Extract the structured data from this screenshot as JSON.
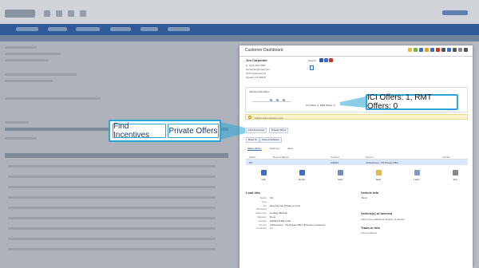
{
  "modal": {
    "title": "Customer Dashboard",
    "toolbar_icon_colors": [
      "#f2b632",
      "#7bb04a",
      "#3b6fc4",
      "#e0a030",
      "#3b6fc4",
      "#c0392b",
      "#555555",
      "#3b6fc4",
      "#555555",
      "#888888",
      "#555555"
    ]
  },
  "customer": {
    "name": "Jim Carpenter",
    "phone": "H: (123) 456-7890",
    "email": "jcarpenter@email.com",
    "address": "3470 Sycamore St",
    "city": "Topeka, KS 66546",
    "search_label": "Search:"
  },
  "vehicle": {
    "section_title": "Vehicle Information",
    "offers_text": "ICI Offers: 1, RMT Offers: 0"
  },
  "alert": {
    "text": "Click to add customer note"
  },
  "buttons": {
    "find_incentives": "Find Incentives",
    "private_offers": "Private Offers",
    "book_to": "Book To",
    "owned_vehicles": "Owned Vehicles"
  },
  "tabs": [
    "Sales History",
    "Deal Log",
    "Value"
  ],
  "grid": {
    "headers": [
      "Status",
      "Buyer/CoBuyer",
      "Created",
      "Source",
      "Vehicle"
    ],
    "rows": [
      {
        "status": "NO",
        "buyer": "",
        "created": "2/18/24",
        "source": "VinSolutions - VS Private Offer",
        "vehicle": ""
      }
    ]
  },
  "actions": [
    {
      "label": "Call",
      "icon": "phone-icon",
      "color": "#3b6fc4"
    },
    {
      "label": "Email",
      "icon": "email-icon",
      "color": "#3b6fc4"
    },
    {
      "label": "Appt",
      "icon": "calendar-icon",
      "color": "#6b8ec9"
    },
    {
      "label": "Note",
      "icon": "note-icon",
      "color": "#e6b84a"
    },
    {
      "label": "Letter",
      "icon": "letter-icon",
      "color": "#7d9bcf"
    },
    {
      "label": "Text",
      "icon": "text-icon",
      "color": "#888888"
    }
  ],
  "lead_info": {
    "title": "Lead Info",
    "rows": [
      {
        "k": "Status",
        "v": "NO",
        "red": false
      },
      {
        "k": "Type",
        "v": "",
        "red": false
      },
      {
        "k": "Src",
        "v": "New Internet Private or Ford",
        "red": false
      },
      {
        "k": "BD Agent",
        "v": "",
        "red": false
      },
      {
        "k": "Sales Rep",
        "v": "Lindsay Mitchell",
        "red": false
      },
      {
        "k": "Manager",
        "v": "None",
        "red": false
      },
      {
        "k": "Created",
        "v": "2/18/24 8:48a (124)",
        "red": false
      },
      {
        "k": "Source",
        "v": "VinSolutions - VS Private Offer (Premium Customer)",
        "red": false
      },
      {
        "k": "Contacted",
        "v": "No",
        "red": true
      }
    ]
  },
  "vehicle_info": {
    "title": "Vehicle Info",
    "value": "(New)",
    "interest_title": "Vehicle(s) of Interest",
    "interest_text": "Click to see additional vehicles of interest",
    "trade_title": "Trade-in Info",
    "trade_text": "(none entered)"
  },
  "callouts": {
    "left_1": "Find Incentives",
    "left_2": "Private Offers",
    "right": "ICI Offers: 1, RMT Offers: 0"
  },
  "colors": {
    "accent": "#2ba6d8",
    "nav": "#2f5ea8",
    "selected_row": "#dbe7fa"
  }
}
